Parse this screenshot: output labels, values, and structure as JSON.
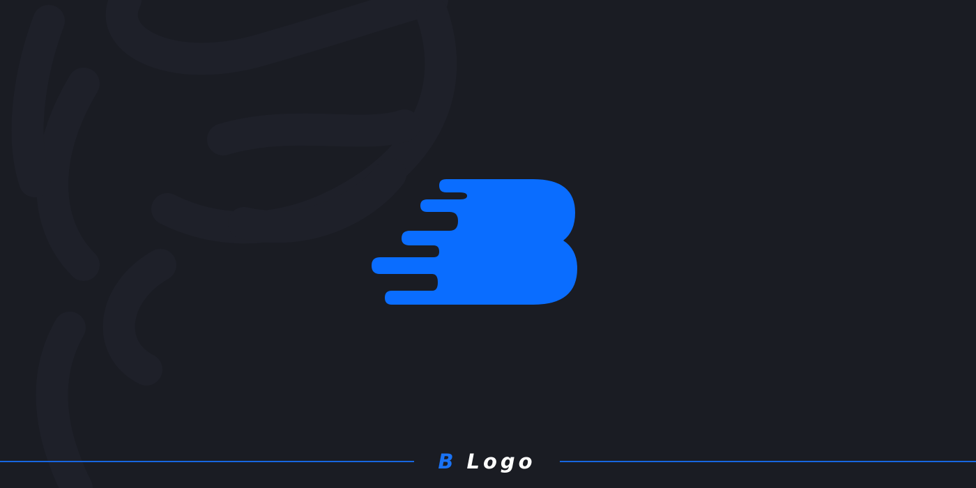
{
  "colors": {
    "background": "#1a1c23",
    "accent": "#0a6dff",
    "line": "#1766e0",
    "text": "#ffffff"
  },
  "logo": {
    "icon": "speed-letter-b-icon"
  },
  "caption": {
    "letter": "B",
    "word": "Logo"
  }
}
